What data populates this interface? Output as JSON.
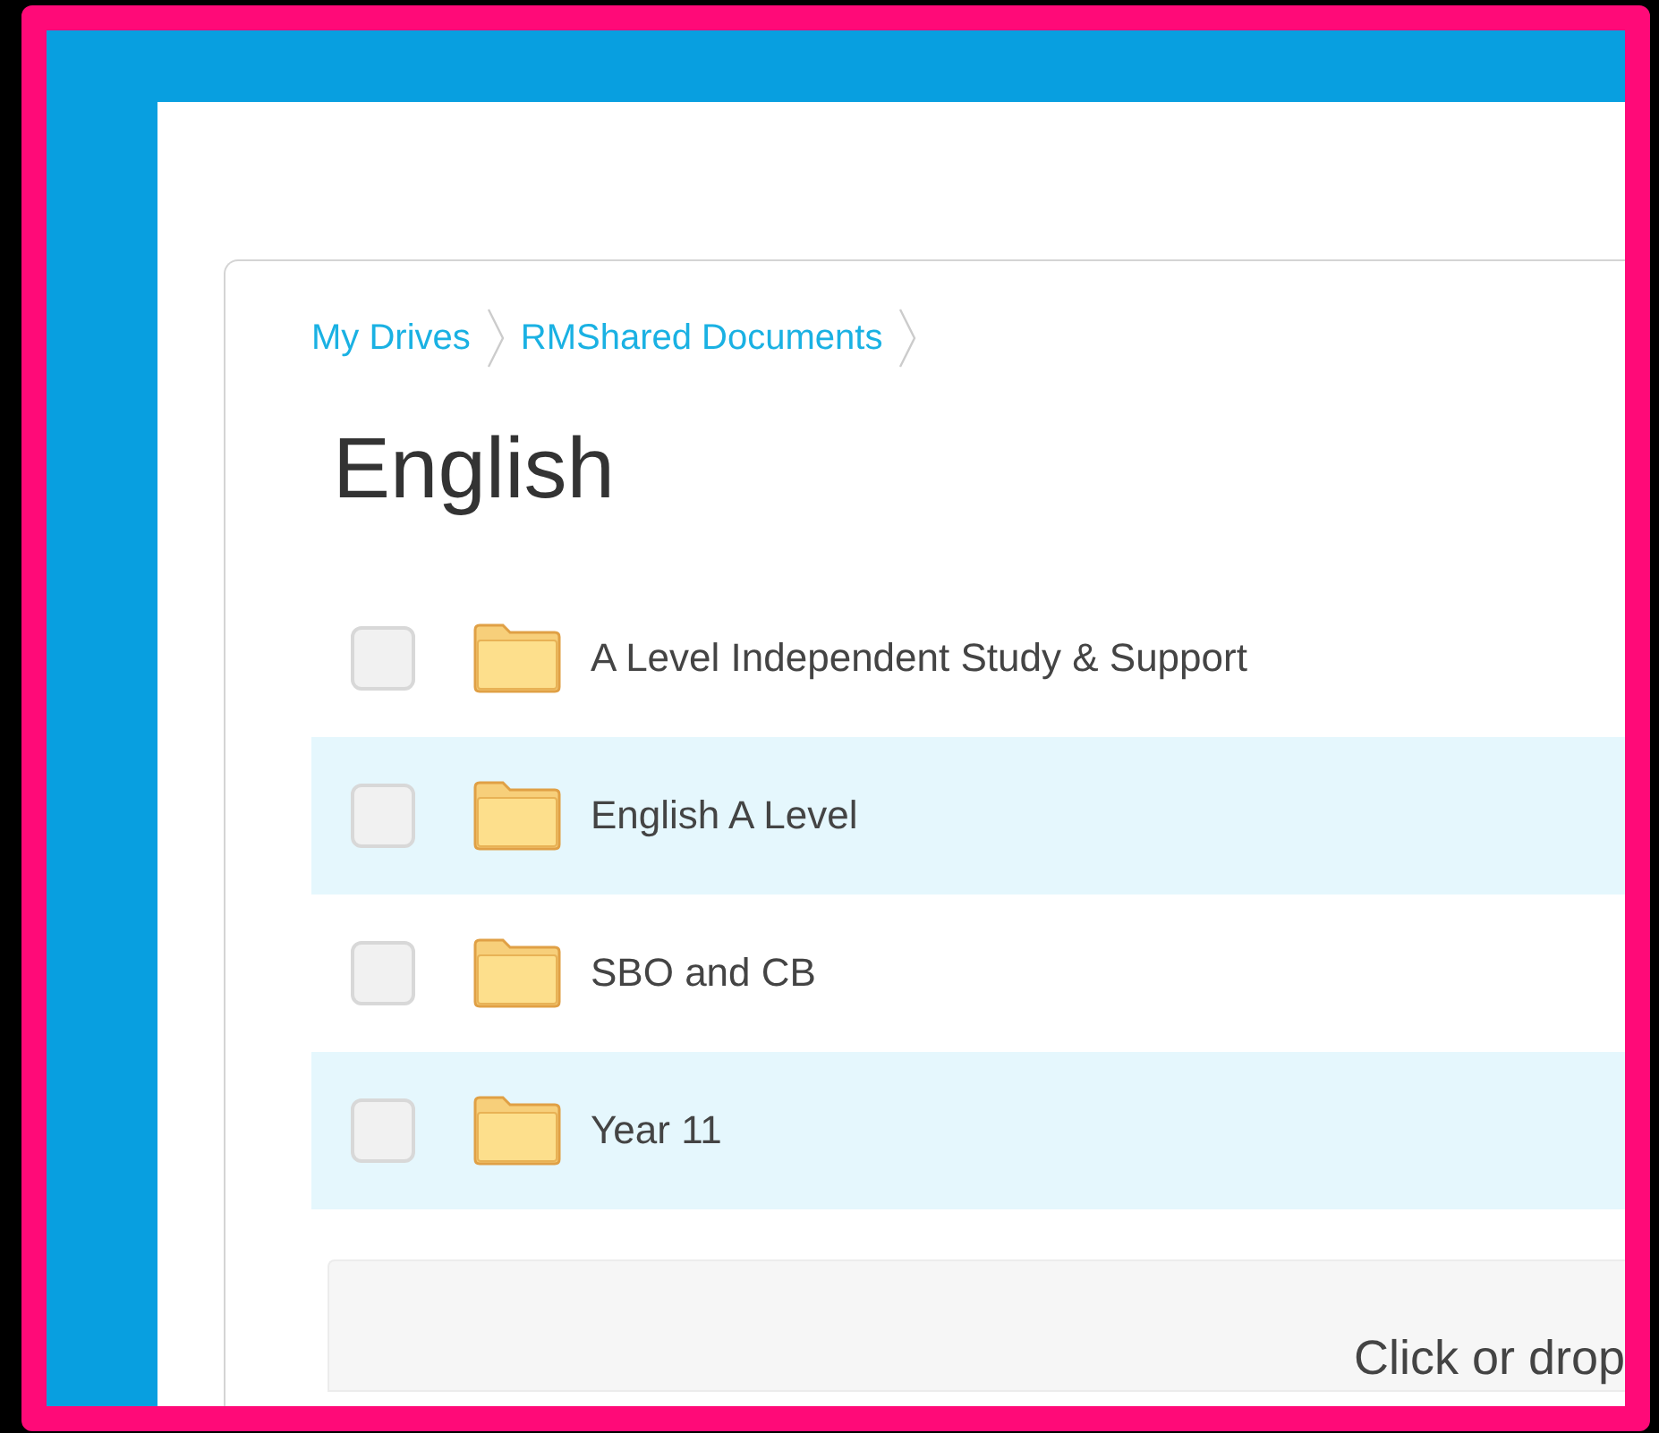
{
  "breadcrumbs": [
    {
      "label": "My Drives"
    },
    {
      "label": "RMShared Documents"
    }
  ],
  "title": "English",
  "folders": [
    {
      "name": "A Level Independent Study & Support",
      "checked": false
    },
    {
      "name": "English A Level",
      "checked": false
    },
    {
      "name": "SBO and CB",
      "checked": false
    },
    {
      "name": "Year 11",
      "checked": false
    }
  ],
  "dropzone": {
    "text": "Click or drop"
  }
}
